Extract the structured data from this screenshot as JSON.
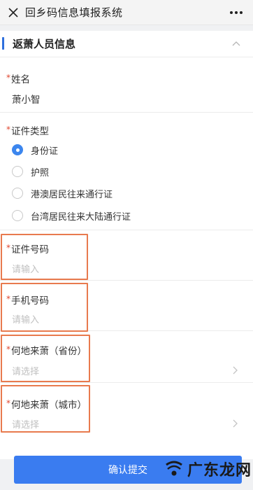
{
  "header": {
    "title": "回乡码信息填报系统"
  },
  "section": {
    "title": "返萧人员信息"
  },
  "fields": {
    "name": {
      "label": "姓名",
      "value": "萧小智"
    },
    "id_type": {
      "label": "证件类型",
      "options": [
        "身份证",
        "护照",
        "港澳居民往来通行证",
        "台湾居民往来大陆通行证"
      ],
      "selected": "身份证"
    },
    "id_number": {
      "label": "证件号码",
      "placeholder": "请输入"
    },
    "phone": {
      "label": "手机号码",
      "placeholder": "请输入"
    },
    "province": {
      "label": "何地来萧（省份）",
      "placeholder": "请选择"
    },
    "city": {
      "label": "何地来萧（城市）",
      "placeholder": "请选择"
    }
  },
  "required_mark": "*",
  "submit_label": "确认提交",
  "watermark": {
    "text": "广东龙网"
  },
  "colors": {
    "accent": "#3a7cf0",
    "required": "#e0462f",
    "highlight": "#e87a4e"
  }
}
